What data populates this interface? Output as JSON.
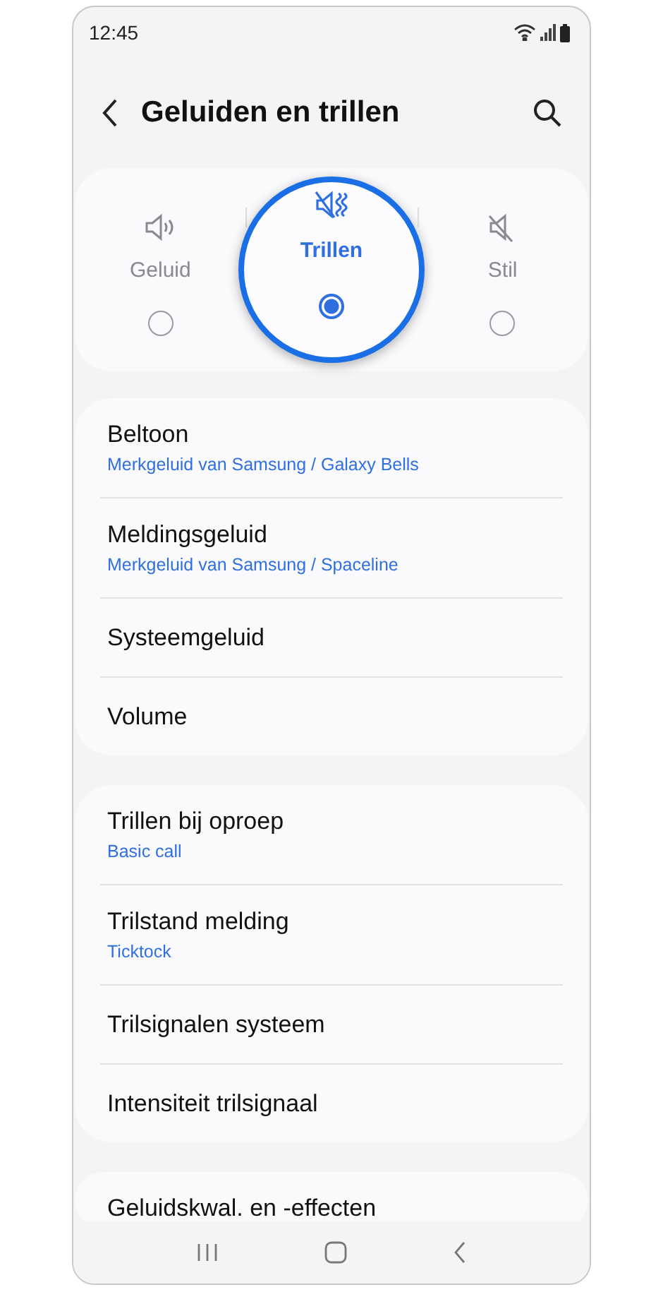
{
  "status_bar": {
    "time": "12:45"
  },
  "header": {
    "title": "Geluiden en trillen"
  },
  "modes": [
    {
      "kind": "sound",
      "label": "Geluid",
      "selected": false
    },
    {
      "kind": "vibrate",
      "label": "Trillen",
      "selected": true
    },
    {
      "kind": "mute",
      "label": "Stil",
      "selected": false
    }
  ],
  "groups": [
    {
      "items": [
        {
          "title": "Beltoon",
          "subtitle": "Merkgeluid van Samsung / Galaxy Bells"
        },
        {
          "title": "Meldingsgeluid",
          "subtitle": "Merkgeluid van Samsung / Spaceline"
        },
        {
          "title": "Systeemgeluid"
        },
        {
          "title": "Volume"
        }
      ]
    },
    {
      "items": [
        {
          "title": "Trillen bij oproep",
          "subtitle": "Basic call"
        },
        {
          "title": "Trilstand melding",
          "subtitle": "Ticktock"
        },
        {
          "title": "Trilsignalen systeem"
        },
        {
          "title": "Intensiteit trilsignaal"
        }
      ]
    },
    {
      "items": [
        {
          "title": "Geluidskwal. en -effecten"
        }
      ]
    }
  ]
}
